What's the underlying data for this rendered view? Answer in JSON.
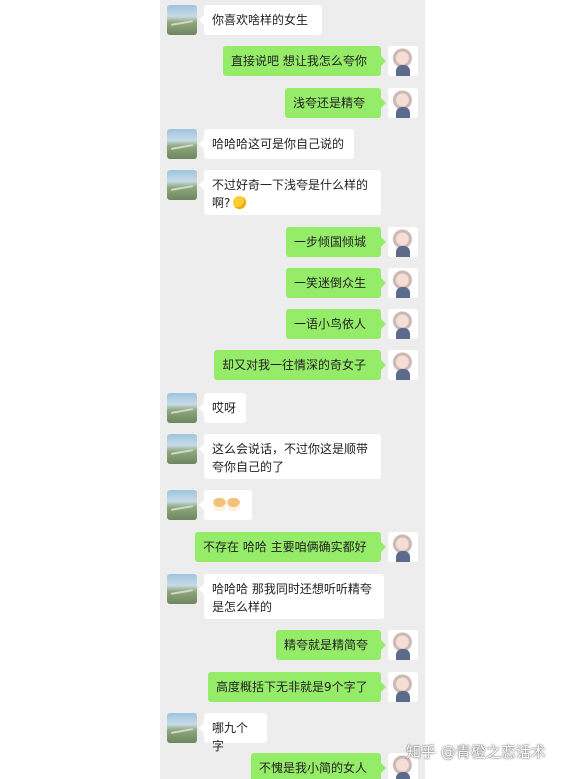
{
  "messages": [
    {
      "side": "in",
      "text": "你喜欢啥样的女生"
    },
    {
      "side": "out",
      "text": "直接说吧 想让我怎么夸你"
    },
    {
      "side": "out",
      "text": "浅夸还是精夸"
    },
    {
      "side": "in",
      "text": "哈哈哈这可是你自己说的"
    },
    {
      "side": "in",
      "text": "不过好奇一下浅夸是什么样的啊?",
      "emoji": "smirk-emoji"
    },
    {
      "side": "out",
      "text": "一步倾国倾城"
    },
    {
      "side": "out",
      "text": "一笑迷倒众生"
    },
    {
      "side": "out",
      "text": "一语小鸟依人"
    },
    {
      "side": "out",
      "text": "却又对我一往情深的奇女子"
    },
    {
      "side": "in",
      "text": "哎呀"
    },
    {
      "side": "in",
      "text": "这么会说话，不过你这是顺带夸你自己的了"
    },
    {
      "side": "in",
      "text": "",
      "emoji": "doge-emoji-pair"
    },
    {
      "side": "out",
      "text": "不存在 哈哈 主要咱俩确实都好"
    },
    {
      "side": "in",
      "text": "哈哈哈 那我同时还想听听精夸是怎么样的"
    },
    {
      "side": "out",
      "text": "精夸就是精简夸"
    },
    {
      "side": "out",
      "text": "高度概括下无非就是9个字了"
    },
    {
      "side": "in",
      "text": "哪九个字"
    },
    {
      "side": "out",
      "text": "不愧是我小简的女人"
    }
  ],
  "watermark": "知乎 @青橙之恋话术",
  "colors": {
    "chat_background": "#ededed",
    "incoming_bubble": "#ffffff",
    "outgoing_bubble": "#95ec69"
  }
}
